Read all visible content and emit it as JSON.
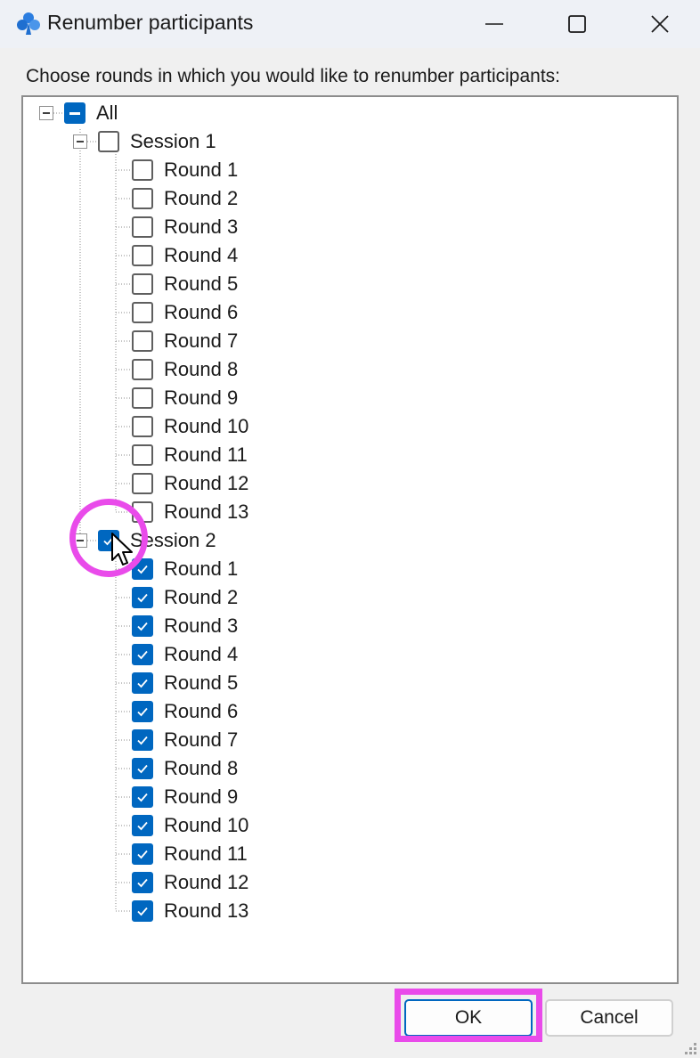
{
  "window": {
    "title": "Renumber participants",
    "icon": "club-suit-icon",
    "accent_color": "#0067c0",
    "highlight_color": "#e94bea"
  },
  "prompt": "Choose rounds in which you would like to renumber participants:",
  "tree": {
    "root": {
      "label": "All",
      "state": "partial",
      "expanded": true
    },
    "sessions": [
      {
        "label": "Session 1",
        "state": "unchecked",
        "expanded": true,
        "rounds": [
          {
            "label": "Round 1",
            "checked": false
          },
          {
            "label": "Round 2",
            "checked": false
          },
          {
            "label": "Round 3",
            "checked": false
          },
          {
            "label": "Round 4",
            "checked": false
          },
          {
            "label": "Round 5",
            "checked": false
          },
          {
            "label": "Round 6",
            "checked": false
          },
          {
            "label": "Round 7",
            "checked": false
          },
          {
            "label": "Round 8",
            "checked": false
          },
          {
            "label": "Round 9",
            "checked": false
          },
          {
            "label": "Round 10",
            "checked": false
          },
          {
            "label": "Round 11",
            "checked": false
          },
          {
            "label": "Round 12",
            "checked": false
          },
          {
            "label": "Round 13",
            "checked": false
          }
        ]
      },
      {
        "label": "Session 2",
        "state": "checked",
        "expanded": true,
        "rounds": [
          {
            "label": "Round 1",
            "checked": true
          },
          {
            "label": "Round 2",
            "checked": true
          },
          {
            "label": "Round 3",
            "checked": true
          },
          {
            "label": "Round 4",
            "checked": true
          },
          {
            "label": "Round 5",
            "checked": true
          },
          {
            "label": "Round 6",
            "checked": true
          },
          {
            "label": "Round 7",
            "checked": true
          },
          {
            "label": "Round 8",
            "checked": true
          },
          {
            "label": "Round 9",
            "checked": true
          },
          {
            "label": "Round 10",
            "checked": true
          },
          {
            "label": "Round 11",
            "checked": true
          },
          {
            "label": "Round 12",
            "checked": true
          },
          {
            "label": "Round 13",
            "checked": true
          }
        ]
      }
    ]
  },
  "buttons": {
    "ok": "OK",
    "cancel": "Cancel"
  }
}
